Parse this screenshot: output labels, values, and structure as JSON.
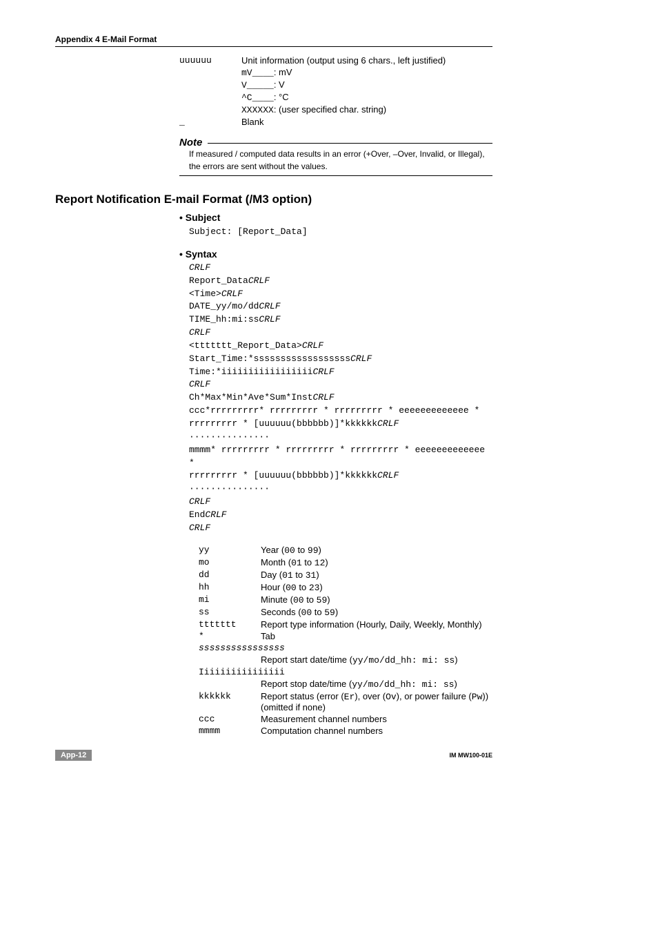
{
  "header": "Appendix 4  E-Mail Format",
  "topDefs": [
    {
      "key": "uuuuuu",
      "val_html": "Unit information (output using 6 chars., left justified)"
    },
    {
      "key": "",
      "val_html": "<span class='mono'>mV____</span>: mV"
    },
    {
      "key": "",
      "val_html": "<span class='mono'>V_____</span>: V"
    },
    {
      "key": "",
      "val_html": "<span class='mono'>^C____</span>: °C"
    },
    {
      "key": "",
      "val_html": "<span class='mono'>XXXXXX</span>: (user specified char. string)"
    },
    {
      "key": "_",
      "val_html": "Blank"
    }
  ],
  "note": {
    "title": "Note",
    "body": "If measured / computed data results in an error (+Over, –Over, Invalid, or Illegal), the errors are sent without the values."
  },
  "section": {
    "title": "Report Notification E-mail Format (/M3 option)",
    "subject": {
      "head": "Subject",
      "line": "Subject: [Report_Data]"
    },
    "syntax": {
      "head": "Syntax",
      "lines": [
        {
          "t": "CRLF",
          "i": true
        },
        {
          "t": "Report_Data",
          "suf": "CRLF"
        },
        {
          "t": "<Time>",
          "suf": "CRLF"
        },
        {
          "t": "DATE_yy/mo/dd",
          "suf": "CRLF"
        },
        {
          "t": "TIME_hh:mi:ss",
          "suf": "CRLF"
        },
        {
          "t": "CRLF",
          "i": true
        },
        {
          "t": "<ttttttt_Report_Data>",
          "suf": "CRLF"
        },
        {
          "t": "Start_Time:*ssssssssssssssssss",
          "suf": "CRLF"
        },
        {
          "t": "Time:*iiiiiiiiiiiiiiiii",
          "suf": "CRLF"
        },
        {
          "t": "CRLF",
          "i": true
        },
        {
          "t": "Ch*Max*Min*Ave*Sum*Inst",
          "suf": "CRLF"
        },
        {
          "t": "ccc*rrrrrrrrr* rrrrrrrrr * rrrrrrrrr * eeeeeeeeeeeee *"
        },
        {
          "t": "  rrrrrrrrr * [uuuuuu(bbbbbb)]*kkkkkk",
          "suf": "CRLF"
        },
        {
          "t": "···············"
        },
        {
          "t": "mmmm* rrrrrrrrr * rrrrrrrrr * rrrrrrrrr * eeeeeeeeeeeee *"
        },
        {
          "t": "  rrrrrrrrr * [uuuuuu(bbbbbb)]*kkkkkk",
          "suf": "CRLF"
        },
        {
          "t": "···············"
        },
        {
          "t": "CRLF",
          "i": true
        },
        {
          "t": "End",
          "suf": "CRLF"
        },
        {
          "t": "CRLF",
          "i": true
        }
      ]
    },
    "defs": [
      {
        "k": "yy",
        "v_html": "Year (<span class='mono'>00</span> to <span class='mono'>99</span>)"
      },
      {
        "k": "mo",
        "v_html": "Month (<span class='mono'>01</span> to <span class='mono'>12</span>)"
      },
      {
        "k": "dd",
        "v_html": "Day (<span class='mono'>01</span> to <span class='mono'>31</span>)"
      },
      {
        "k": "hh",
        "v_html": "Hour (<span class='mono'>00</span> to <span class='mono'>23</span>)"
      },
      {
        "k": "mi",
        "v_html": "Minute (<span class='mono'>00</span> to <span class='mono'>59</span>)"
      },
      {
        "k": "ss",
        "v_html": "Seconds (<span class='mono'>00</span> to <span class='mono'>59</span>)"
      },
      {
        "k": "ttttttt",
        "v_html": "Report type information (Hourly, Daily, Weekly, Monthly)"
      },
      {
        "k": "*",
        "v_html": "Tab"
      },
      {
        "k": "ssssssssssssssss",
        "full": true,
        "ital": true
      },
      {
        "k": "",
        "v_html": "Report start date/time (<span class='mono'>yy/mo/dd_hh: mi: ss</span>)"
      },
      {
        "k": "Iiiiiiiiiiiiiiii",
        "full": true
      },
      {
        "k": "",
        "v_html": "Report stop date/time (<span class='mono'>yy/mo/dd_hh: mi: ss</span>)"
      },
      {
        "k": "kkkkkk",
        "v_html": "Report status (error (<span class='mono'>Er</span>), over (<span class='mono'>Ov</span>), or power failure (<span class='mono'>Pw</span>)) (omitted if none)"
      },
      {
        "k": "ccc",
        "v_html": "Measurement channel numbers"
      },
      {
        "k": "mmmm",
        "v_html": "Computation channel numbers"
      }
    ]
  },
  "footer": {
    "left": "App-12",
    "right": "IM MW100-01E"
  }
}
